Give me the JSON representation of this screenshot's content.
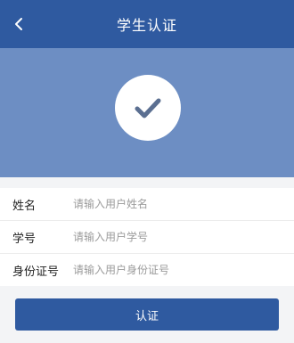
{
  "header": {
    "title": "学生认证",
    "back_icon": "chevron-left-icon"
  },
  "hero": {
    "icon": "check-icon"
  },
  "form": {
    "fields": [
      {
        "label": "姓名",
        "placeholder": "请输入用户姓名",
        "value": ""
      },
      {
        "label": "学号",
        "placeholder": "请输入用户学号",
        "value": ""
      },
      {
        "label": "身份证号",
        "placeholder": "请输入用户身份证号",
        "value": ""
      }
    ]
  },
  "submit": {
    "label": "认证"
  },
  "colors": {
    "primary": "#2f5aa0",
    "hero": "#6d8ec3",
    "background": "#f3f4f6"
  }
}
